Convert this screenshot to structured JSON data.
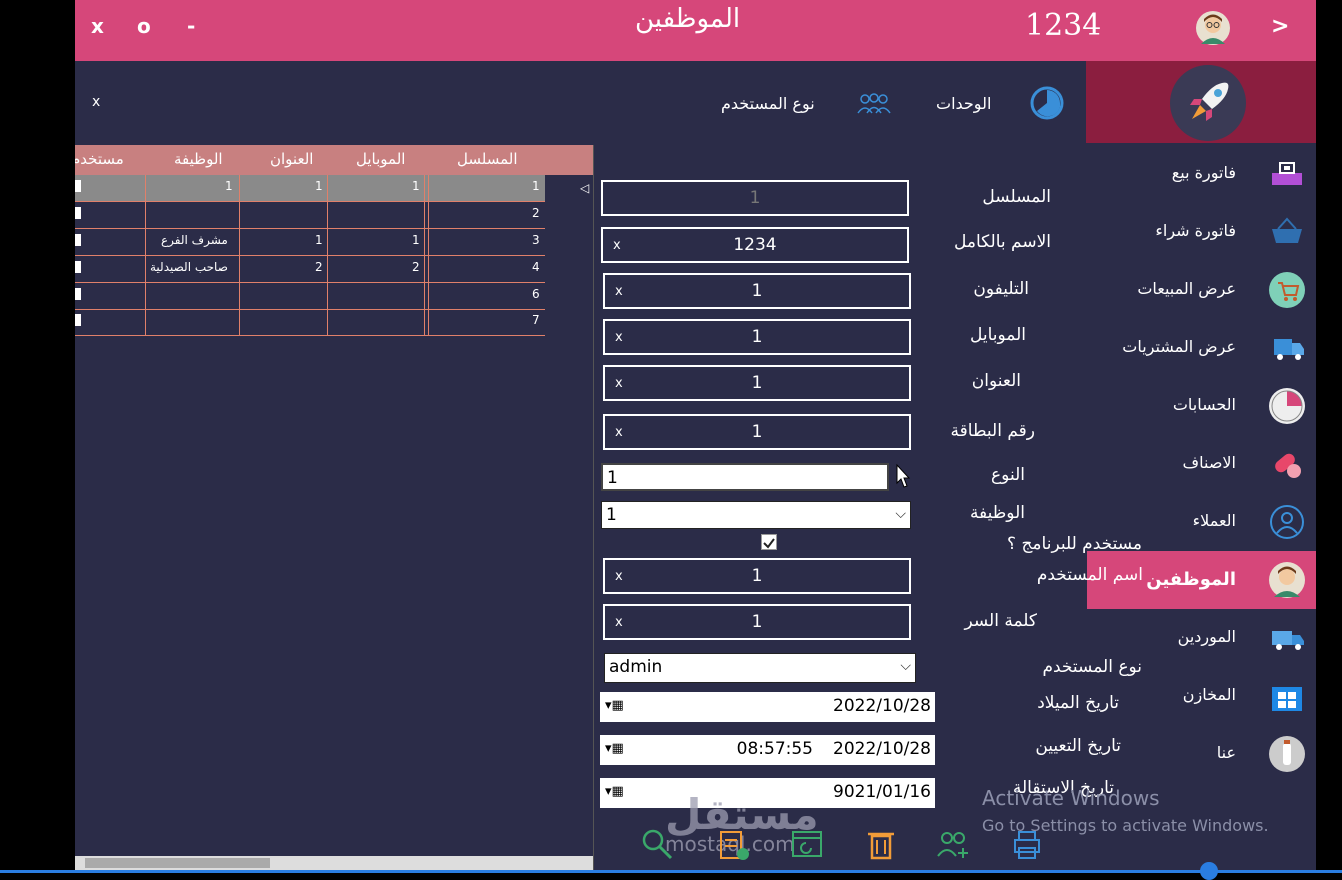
{
  "titlebar": {
    "controls": [
      "x",
      "o",
      "-"
    ],
    "title": "الموظفين",
    "user_id": "1234",
    "next": ">"
  },
  "toptabs": {
    "units": "الوحدات",
    "user_type": "نوع المستخدم",
    "close": "x"
  },
  "sidebar": {
    "items": [
      {
        "label": "فاتورة بيع",
        "icon": "register-icon"
      },
      {
        "label": "فاتورة شراء",
        "icon": "basket-icon"
      },
      {
        "label": "عرض المبيعات",
        "icon": "cart-icon"
      },
      {
        "label": "عرض المشتريات",
        "icon": "truck-icon"
      },
      {
        "label": "الحسابات",
        "icon": "pie-chart-icon"
      },
      {
        "label": "الاصناف",
        "icon": "pills-icon"
      },
      {
        "label": "العملاء",
        "icon": "user-circle-icon"
      },
      {
        "label": "الموظفين",
        "icon": "employee-avatar-icon",
        "active": true
      },
      {
        "label": "الموردين",
        "icon": "delivery-truck-icon"
      },
      {
        "label": "المخازن",
        "icon": "windows-store-icon"
      },
      {
        "label": "عنا",
        "icon": "bottle-icon"
      }
    ]
  },
  "form": {
    "serial": {
      "label": "المسلسل",
      "value": "1"
    },
    "full_name": {
      "label": "الاسم بالكامل",
      "value": "1234"
    },
    "phone": {
      "label": "التليفون",
      "value": "1"
    },
    "mobile": {
      "label": "الموبايل",
      "value": "1"
    },
    "address": {
      "label": "العنوان",
      "value": "1"
    },
    "card_number": {
      "label": "رقم البطاقة",
      "value": "1"
    },
    "type": {
      "label": "النوع",
      "value": "1"
    },
    "job": {
      "label": "الوظيفة",
      "value": "1"
    },
    "is_user": {
      "label": "مستخدم للبرنامج ؟",
      "checked": true
    },
    "username": {
      "label": "اسم المستخدم",
      "value": "1"
    },
    "password": {
      "label": "كلمة السر",
      "value": "1"
    },
    "user_type": {
      "label": "نوع المستخدم",
      "value": "admin"
    },
    "birth_date": {
      "label": "تاريخ الميلاد",
      "value": "2022/10/28"
    },
    "hire_date": {
      "label": "تاريخ التعيين",
      "date": "2022/10/28",
      "time": "08:57:55"
    },
    "resign_date": {
      "label": "تاريخ الاستقالة",
      "value": "9021/01/16"
    },
    "clear_symbol": "x"
  },
  "grid": {
    "columns": [
      "المسلسل",
      "الموبايل",
      "العنوان",
      "الوظيفة",
      "مستخدم"
    ],
    "rows": [
      {
        "serial": "1",
        "mobile": "1",
        "address": "1",
        "job": "1",
        "selected": true
      },
      {
        "serial": "2",
        "mobile": "",
        "address": "",
        "job": ""
      },
      {
        "serial": "3",
        "mobile": "1",
        "address": "1",
        "job": "مشرف الفرع"
      },
      {
        "serial": "4",
        "mobile": "2",
        "address": "2",
        "job": "صاحب الصيدلية"
      },
      {
        "serial": "6",
        "mobile": "",
        "address": "",
        "job": ""
      },
      {
        "serial": "7",
        "mobile": "",
        "address": "",
        "job": ""
      }
    ]
  },
  "bottom_actions": [
    "search-icon",
    "new-document-icon",
    "refresh-icon",
    "trash-icon",
    "add-users-icon",
    "printer-icon"
  ],
  "watermark": {
    "line1": "Activate Windows",
    "line2": "Go to Settings to activate Windows.",
    "brand": "مستقل",
    "brand_url": "mostaql.com"
  },
  "colors": {
    "accent": "#d6477a",
    "bg": "#2b2c48",
    "logo_bg": "#8b1e3f",
    "grid_header": "#c88080"
  }
}
